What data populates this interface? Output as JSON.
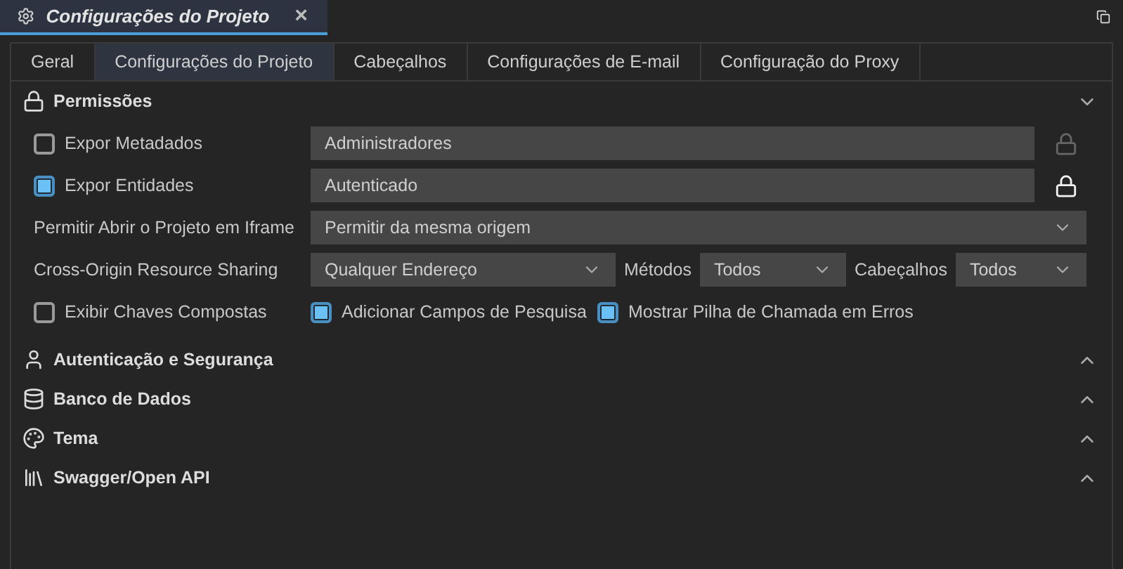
{
  "document_tab": {
    "title": "Configurações do Projeto",
    "close": "×"
  },
  "tabs": [
    {
      "label": "Geral",
      "selected": false
    },
    {
      "label": "Configurações do Projeto",
      "selected": true
    },
    {
      "label": "Cabeçalhos",
      "selected": false
    },
    {
      "label": "Configurações de E-mail",
      "selected": false
    },
    {
      "label": "Configuração do Proxy",
      "selected": false
    }
  ],
  "sections": [
    {
      "title": "Permissões",
      "kind": "lock",
      "expanded": true
    },
    {
      "title": "Autenticação e Segurança",
      "kind": "user",
      "expanded": false
    },
    {
      "title": "Banco de Dados",
      "kind": "database",
      "expanded": false
    },
    {
      "title": "Tema",
      "kind": "palette",
      "expanded": false
    },
    {
      "title": "Swagger/Open API",
      "kind": "books",
      "expanded": false
    }
  ],
  "permissions": {
    "exposures": [
      {
        "label": "Expor Metadados",
        "checked": false,
        "value": "Administradores",
        "lock_active": false
      },
      {
        "label": "Expor Entidades",
        "checked": true,
        "value": "Autenticado",
        "lock_active": true
      }
    ],
    "iframe": {
      "label": "Permitir Abrir o Projeto em Iframe",
      "value": "Permitir da mesma origem"
    },
    "cors": {
      "label": "Cross-Origin Resource Sharing",
      "value": "Qualquer Endereço",
      "methods_label": "Métodos",
      "methods_value": "Todos",
      "headers_label": "Cabeçalhos",
      "headers_value": "Todos"
    },
    "options": [
      {
        "label": "Exibir Chaves Compostas",
        "checked": false
      },
      {
        "label": "Adicionar Campos de Pesquisa",
        "checked": true
      },
      {
        "label": "Mostrar Pilha de Chamada em Erros",
        "checked": true
      }
    ]
  }
}
